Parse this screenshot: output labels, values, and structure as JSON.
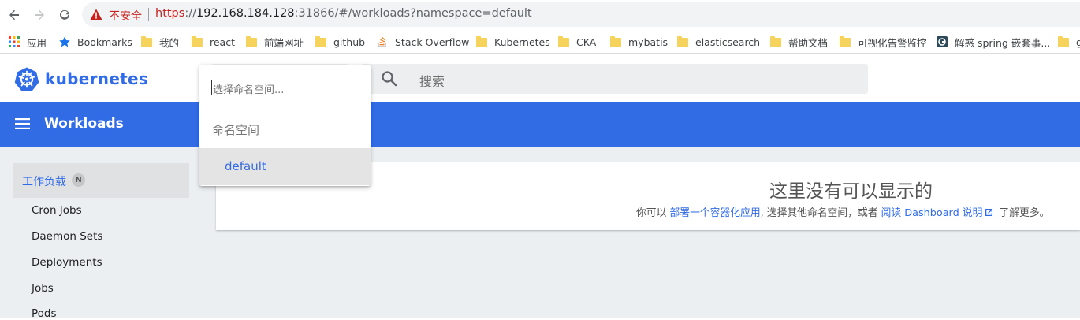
{
  "browser": {
    "insecure_label": "不安全",
    "url_protocol": "https",
    "url_separator": "://",
    "url_host": "192.168.184.128",
    "url_rest": ":31866/#/workloads?namespace=default",
    "bookmarks": [
      {
        "label": "应用",
        "icon": "apps-grid-icon"
      },
      {
        "label": "Bookmarks",
        "icon": "star-icon"
      },
      {
        "label": "我的",
        "icon": "folder-icon"
      },
      {
        "label": "react",
        "icon": "folder-icon"
      },
      {
        "label": "前端网址",
        "icon": "folder-icon"
      },
      {
        "label": "github",
        "icon": "folder-icon"
      },
      {
        "label": "Stack Overflow",
        "icon": "stackoverflow-icon"
      },
      {
        "label": "Kubernetes",
        "icon": "folder-icon"
      },
      {
        "label": "CKA",
        "icon": "folder-icon"
      },
      {
        "label": "mybatis",
        "icon": "folder-icon"
      },
      {
        "label": "elasticsearch",
        "icon": "folder-icon"
      },
      {
        "label": "帮助文档",
        "icon": "folder-icon"
      },
      {
        "label": "可视化告警监控",
        "icon": "folder-icon"
      },
      {
        "label": "解惑 spring 嵌套事...",
        "icon": "site-icon"
      },
      {
        "label": "g",
        "icon": "folder-icon"
      }
    ]
  },
  "header": {
    "brand": "kubernetes",
    "search_placeholder": "搜索"
  },
  "toolbar": {
    "title": "Workloads"
  },
  "sidebar": {
    "section_label": "工作负载",
    "section_badge": "N",
    "items": [
      "Cron Jobs",
      "Daemon Sets",
      "Deployments",
      "Jobs",
      "Pods"
    ]
  },
  "main": {
    "empty_title": "这里没有可以显示的",
    "desc_prefix": "你可以 ",
    "desc_link1": "部署一个容器化应用",
    "desc_middle": ", 选择其他命名空间，或者 ",
    "desc_link2": "阅读 Dashboard 说明",
    "desc_suffix": " 了解更多。"
  },
  "namespace_dropdown": {
    "input_placeholder": "选择命名空间...",
    "group_label": "命名空间",
    "selected_option": "default"
  },
  "colors": {
    "brand_blue": "#326ce5",
    "insecure_red": "#c5221f"
  }
}
